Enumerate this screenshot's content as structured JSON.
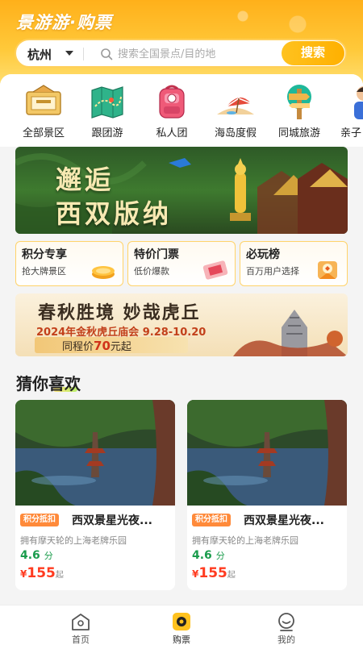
{
  "header": {
    "app_title": "景游游·购票",
    "city": "杭州",
    "search_placeholder": "搜索全国景点/目的地",
    "search_button": "搜索"
  },
  "categories": [
    {
      "label": "全部景区",
      "icon": "ticket-icon"
    },
    {
      "label": "跟团游",
      "icon": "map-icon"
    },
    {
      "label": "私人团",
      "icon": "backpack-icon"
    },
    {
      "label": "海岛度假",
      "icon": "island-icon"
    },
    {
      "label": "同城旅游",
      "icon": "signpost-icon"
    },
    {
      "label": "亲子",
      "icon": "family-icon"
    }
  ],
  "banner": {
    "line1": "邂逅",
    "line2": "西双版纳"
  },
  "promos": [
    {
      "title": "积分专享",
      "subtitle": "抢大牌景区"
    },
    {
      "title": "特价门票",
      "subtitle": "低价爆款"
    },
    {
      "title": "必玩榜",
      "subtitle": "百万用户选择"
    }
  ],
  "festival": {
    "title": "春秋胜境 妙哉虎丘",
    "subtitle": "2024年金秋虎丘庙会 9.28-10.20",
    "price_prefix": "同程价",
    "price": "70",
    "price_suffix": "元起"
  },
  "section_title": "猜你喜欢",
  "products": [
    {
      "tag": "积分抵扣",
      "name": "西双景星光夜...",
      "desc": "拥有摩天轮的上海老牌乐园",
      "rating": "4.6",
      "rating_unit": "分",
      "currency": "¥",
      "price": "155",
      "price_suffix": "起"
    },
    {
      "tag": "积分抵扣",
      "name": "西双景星光夜...",
      "desc": "拥有摩天轮的上海老牌乐园",
      "rating": "4.6",
      "rating_unit": "分",
      "currency": "¥",
      "price": "155",
      "price_suffix": "起"
    }
  ],
  "bottom_nav": [
    {
      "label": "首页",
      "icon": "home-icon",
      "active": false
    },
    {
      "label": "购票",
      "icon": "ticket-icon",
      "active": true
    },
    {
      "label": "我的",
      "icon": "profile-icon",
      "active": false
    }
  ],
  "colors": {
    "brand": "#ffb000",
    "price": "#ff3b20",
    "rating": "#1a9c4c",
    "tag": "#ff8a3a"
  }
}
